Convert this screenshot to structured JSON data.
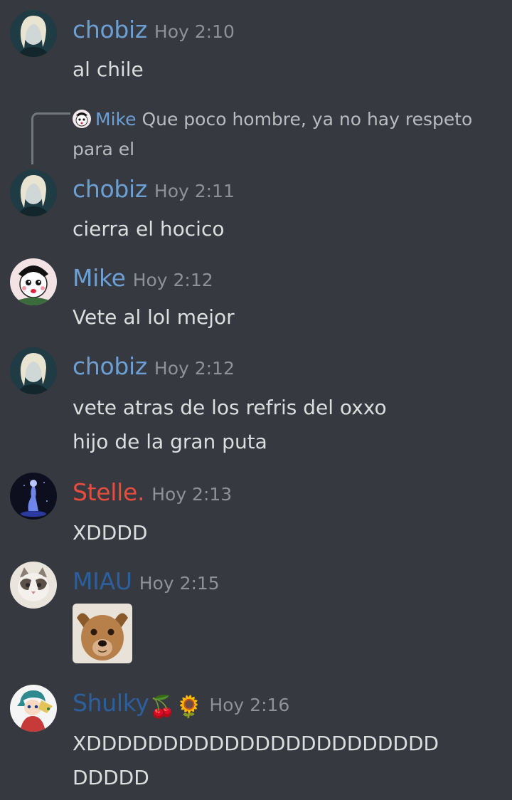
{
  "colors": {
    "background": "#36393f",
    "text": "#dcddde",
    "timestamp": "#8e9297",
    "blue_role": "#6c9fd4",
    "red_role": "#e74c3c",
    "dark_blue_role": "#2b5f9e"
  },
  "reply": {
    "author": "Mike",
    "text": "Que poco hombre, ya no hay respeto para el"
  },
  "messages": [
    {
      "author": "chobiz",
      "time": "Hoy 2:10",
      "lines": "al chile",
      "avatar": "chobiz-avatar"
    },
    {
      "author": "chobiz",
      "time": "Hoy 2:11",
      "lines": "cierra el hocico",
      "avatar": "chobiz-avatar"
    },
    {
      "author": "Mike",
      "time": "Hoy 2:12",
      "lines": "Vete al lol mejor",
      "avatar": "mike-avatar"
    },
    {
      "author": "chobiz",
      "time": "Hoy 2:12",
      "lines": "vete atras de los refris del oxxo\nhijo de la gran puta",
      "avatar": "chobiz-avatar"
    },
    {
      "author": "Stelle.",
      "time": "Hoy 2:13",
      "lines": "XDDDD",
      "avatar": "stelle-avatar"
    },
    {
      "author": "MIAU",
      "time": "Hoy 2:15",
      "attachment": "dog-image",
      "avatar": "cat-avatar"
    },
    {
      "author": "Shulky",
      "author_emoji": "🍒🌻",
      "time": "Hoy 2:16",
      "lines": "XDDDDDDDDDDDDDDDDDDDDDDD\nDDDDD",
      "avatar": "shulky-avatar"
    }
  ]
}
